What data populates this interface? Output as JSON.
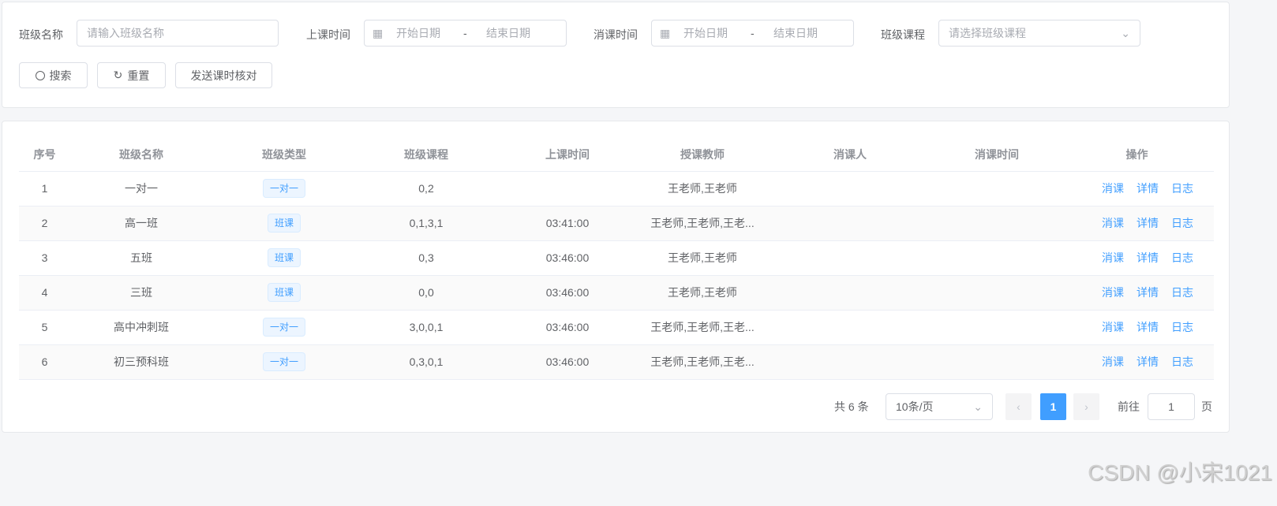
{
  "filters": {
    "class_name": {
      "label": "班级名称",
      "placeholder": "请输入班级名称"
    },
    "class_time": {
      "label": "上课时间",
      "start": "开始日期",
      "sep": "-",
      "end": "结束日期"
    },
    "cancel_time": {
      "label": "消课时间",
      "start": "开始日期",
      "sep": "-",
      "end": "结束日期"
    },
    "course": {
      "label": "班级课程",
      "placeholder": "请选择班级课程"
    }
  },
  "buttons": {
    "search": "搜索",
    "reset": "重置",
    "send": "发送课时核对"
  },
  "table": {
    "columns": [
      "序号",
      "班级名称",
      "班级类型",
      "班级课程",
      "上课时间",
      "授课教师",
      "消课人",
      "消课时间",
      "操作"
    ],
    "rows": [
      {
        "no": "1",
        "name": "一对一",
        "type": "一对一",
        "course": "0,2",
        "time": "",
        "teacher": "王老师,王老师",
        "canceler": "",
        "cancel_time": ""
      },
      {
        "no": "2",
        "name": "高一班",
        "type": "班课",
        "course": "0,1,3,1",
        "time": "03:41:00",
        "teacher": "王老师,王老师,王老...",
        "canceler": "",
        "cancel_time": ""
      },
      {
        "no": "3",
        "name": "五班",
        "type": "班课",
        "course": "0,3",
        "time": "03:46:00",
        "teacher": "王老师,王老师",
        "canceler": "",
        "cancel_time": ""
      },
      {
        "no": "4",
        "name": "三班",
        "type": "班课",
        "course": "0,0",
        "time": "03:46:00",
        "teacher": "王老师,王老师",
        "canceler": "",
        "cancel_time": ""
      },
      {
        "no": "5",
        "name": "高中冲刺班",
        "type": "一对一",
        "course": "3,0,0,1",
        "time": "03:46:00",
        "teacher": "王老师,王老师,王老...",
        "canceler": "",
        "cancel_time": ""
      },
      {
        "no": "6",
        "name": "初三预科班",
        "type": "一对一",
        "course": "0,3,0,1",
        "time": "03:46:00",
        "teacher": "王老师,王老师,王老...",
        "canceler": "",
        "cancel_time": ""
      }
    ],
    "actions": [
      "消课",
      "详情",
      "日志"
    ]
  },
  "pagination": {
    "total": "共 6 条",
    "page_size": "10条/页",
    "current": "1",
    "goto_label": "前往",
    "goto_value": "1",
    "page_suffix": "页"
  },
  "watermark": "CSDN @小宋1021",
  "colors": {
    "primary": "#409eff"
  }
}
